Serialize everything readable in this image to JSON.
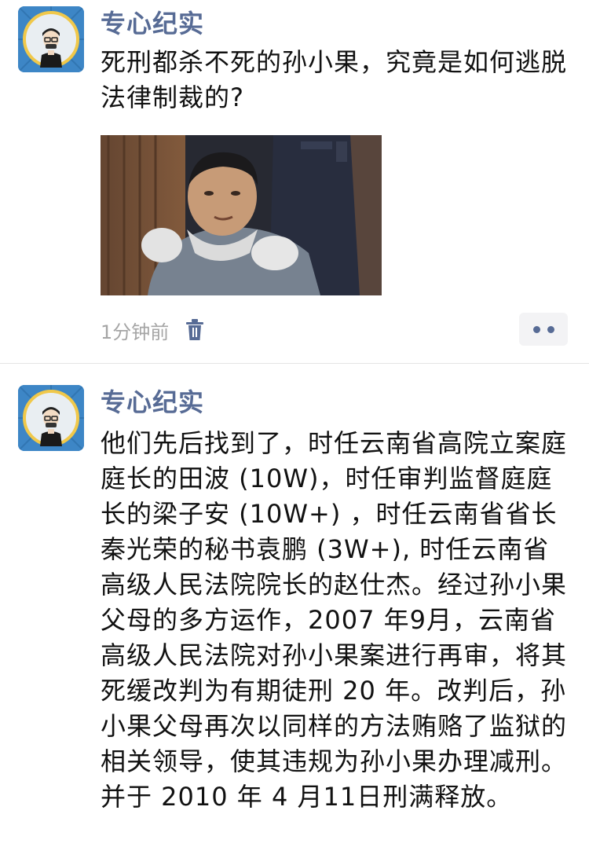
{
  "posts": [
    {
      "author": "专心纪实",
      "text": "死刑都杀不死的孙小果，究竟是如何逃脱法律制裁的?",
      "time": "1分钟前",
      "has_image": true
    },
    {
      "author": "专心纪实",
      "text": "他们先后找到了，时任云南省高院立案庭庭长的田波 (10W)，时任审判监督庭庭长的梁子安 (10W+) ，时任云南省省长秦光荣的秘书袁鹏 (3W+), 时任云南省高级人民法院院长的赵仕杰。经过孙小果父母的多方运作，2007 年9月，云南省高级人民法院对孙小果案进行再审，将其死缓改判为有期徒刑 20 年。改判后，孙小果父母再次以同样的方法贿赂了监狱的相关领导，使其违规为孙小果办理减刑。并于 2010 年 4 月11日刑满释放。"
    }
  ],
  "icons": {
    "avatar": "cartoon-person-avatar",
    "delete": "trash-icon",
    "more": "more-dots-icon"
  },
  "colors": {
    "author_name": "#576b95",
    "text": "#111111",
    "timestamp": "#a5a5a5",
    "more_button_bg": "#f3f3f5"
  }
}
